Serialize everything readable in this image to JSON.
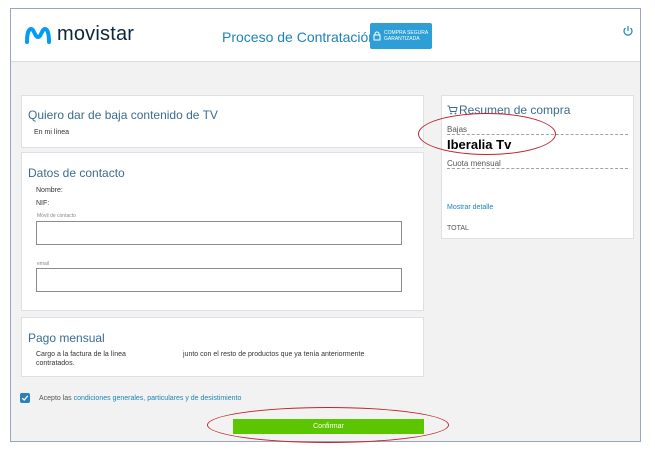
{
  "header": {
    "brand": "movistar",
    "process_title": "Proceso de Contratación",
    "badge_line1": "COMPRA SEGURA",
    "badge_line2": "GARANTIZADA"
  },
  "baja": {
    "title": "Quiero dar de baja contenido de TV",
    "subtitle": "En mi línea"
  },
  "contacto": {
    "title": "Datos de contacto",
    "nombre_label": "Nombre:",
    "nif_label": "NIF:",
    "movil_label": "Móvil de contacto",
    "email_label": "email"
  },
  "pago": {
    "title": "Pago mensual",
    "text_a": "Cargo a la factura de la línea",
    "text_b": "junto con el resto de productos que ya tenía anteriormente",
    "text_c": "contratados."
  },
  "resumen": {
    "title": "Resumen de compra",
    "bajas_label": "Bajas",
    "bajas_value": "Iberalia Tv",
    "cuota_label": "Cuota mensual",
    "detalle_link": "Mostrar detalle",
    "total_label": "TOTAL"
  },
  "terms": {
    "prefix": "Acepto las",
    "link": "condiciones generales, particulares y de desistimiento"
  },
  "confirm_label": "Confirmar",
  "colors": {
    "accent": "#1b84b8",
    "button": "#5bc500",
    "annotation": "#c0242a"
  }
}
